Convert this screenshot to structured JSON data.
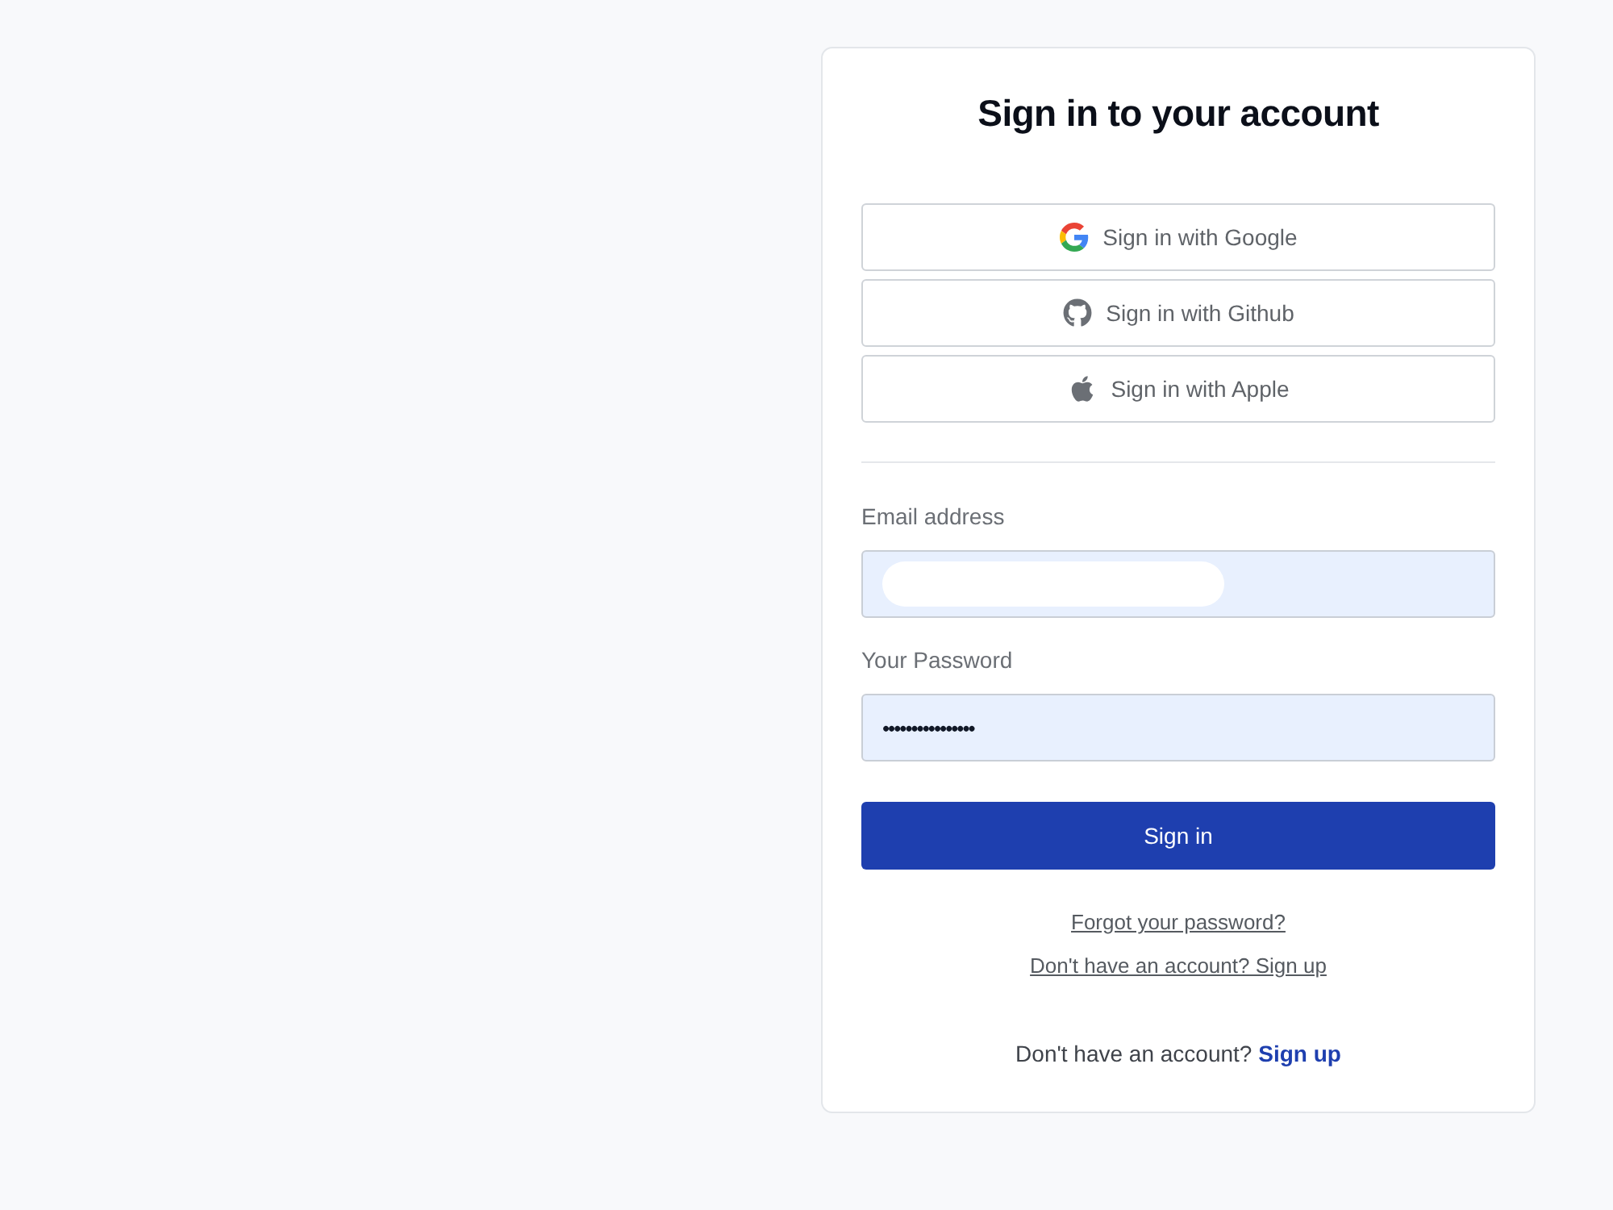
{
  "title": "Sign in to your account",
  "social_buttons": [
    {
      "kind": "google",
      "label": "Sign in with Google"
    },
    {
      "kind": "github",
      "label": "Sign in with Github"
    },
    {
      "kind": "apple",
      "label": "Sign in with Apple"
    }
  ],
  "fields": [
    {
      "label": "Email address",
      "redacted": true
    },
    {
      "label": "Your Password",
      "value": "••••••••••••••••"
    }
  ],
  "submit_button": "Sign in",
  "links": [
    "Forgot your password?",
    "Don't have an account? Sign up"
  ],
  "footer": {
    "text": "Don't have an account?",
    "link": "Sign up"
  }
}
